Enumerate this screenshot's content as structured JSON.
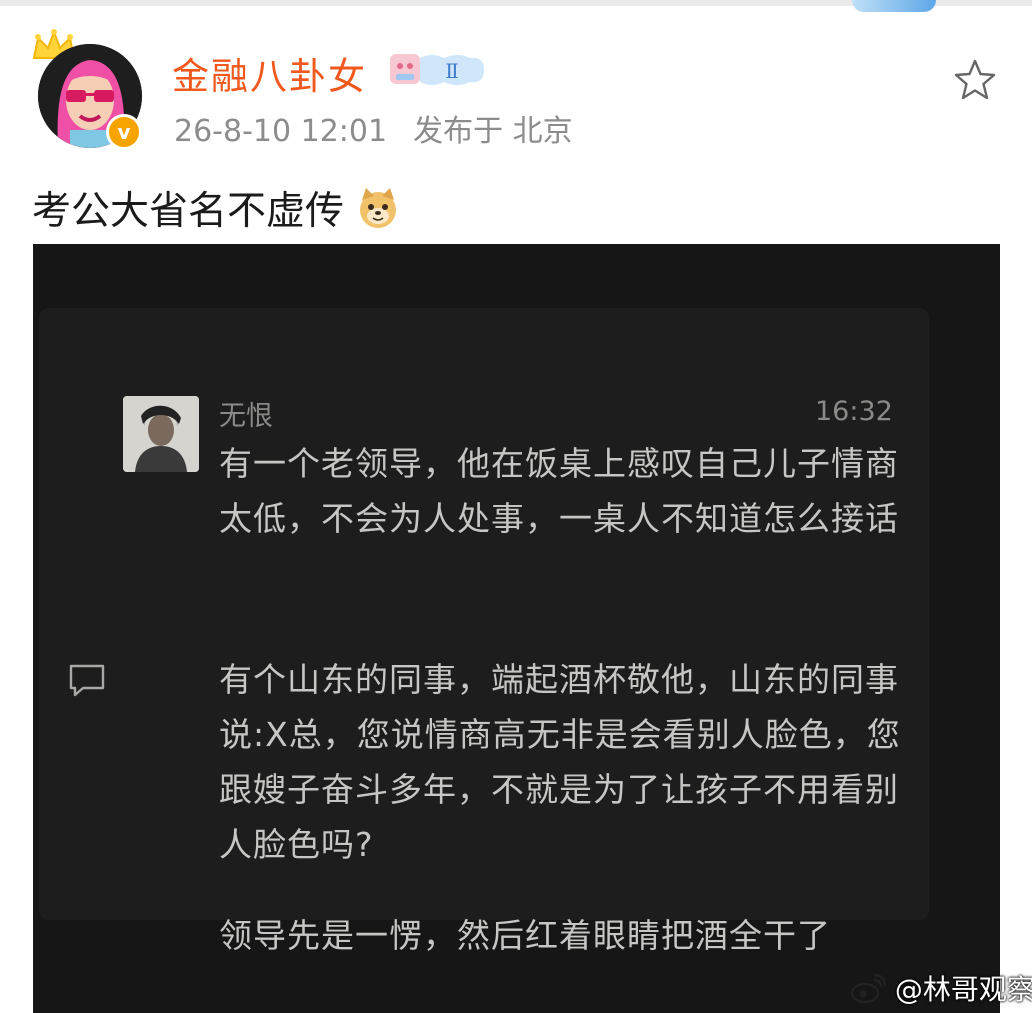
{
  "post": {
    "author": "金融八卦女",
    "level_badge": "Ⅱ",
    "timestamp": "26-8-10 12:01",
    "location": "发布于 北京",
    "text": "考公大省名不虚传",
    "emoji": "doge-emoji"
  },
  "screenshot": {
    "sender": "无恨",
    "time": "16:32",
    "paragraphs": [
      "有一个老领导，他在饭桌上感叹自己儿子情商太低，不会为人处事，一桌人不知道怎么接话",
      "有个山东的同事，端起酒杯敬他，山东的同事说:X总，您说情商高无非是会看别人脸色，您跟嫂子奋斗多年，不就是为了让孩子不用看别人脸色吗?",
      "领导先是一愣，然后红着眼睛把酒全干了"
    ]
  },
  "watermark": "@林哥观察",
  "icons": {
    "favorite": "star-icon",
    "comment": "comment-icon",
    "verified": "verified-badge-icon",
    "crown": "crown-icon",
    "weibo": "weibo-logo-icon"
  },
  "colors": {
    "username": "#f0581d",
    "meta_text": "#8c8c8c",
    "verified_badge": "#f7a400",
    "screenshot_bg": "#151615",
    "screenshot_text": "#c6c6c4"
  }
}
